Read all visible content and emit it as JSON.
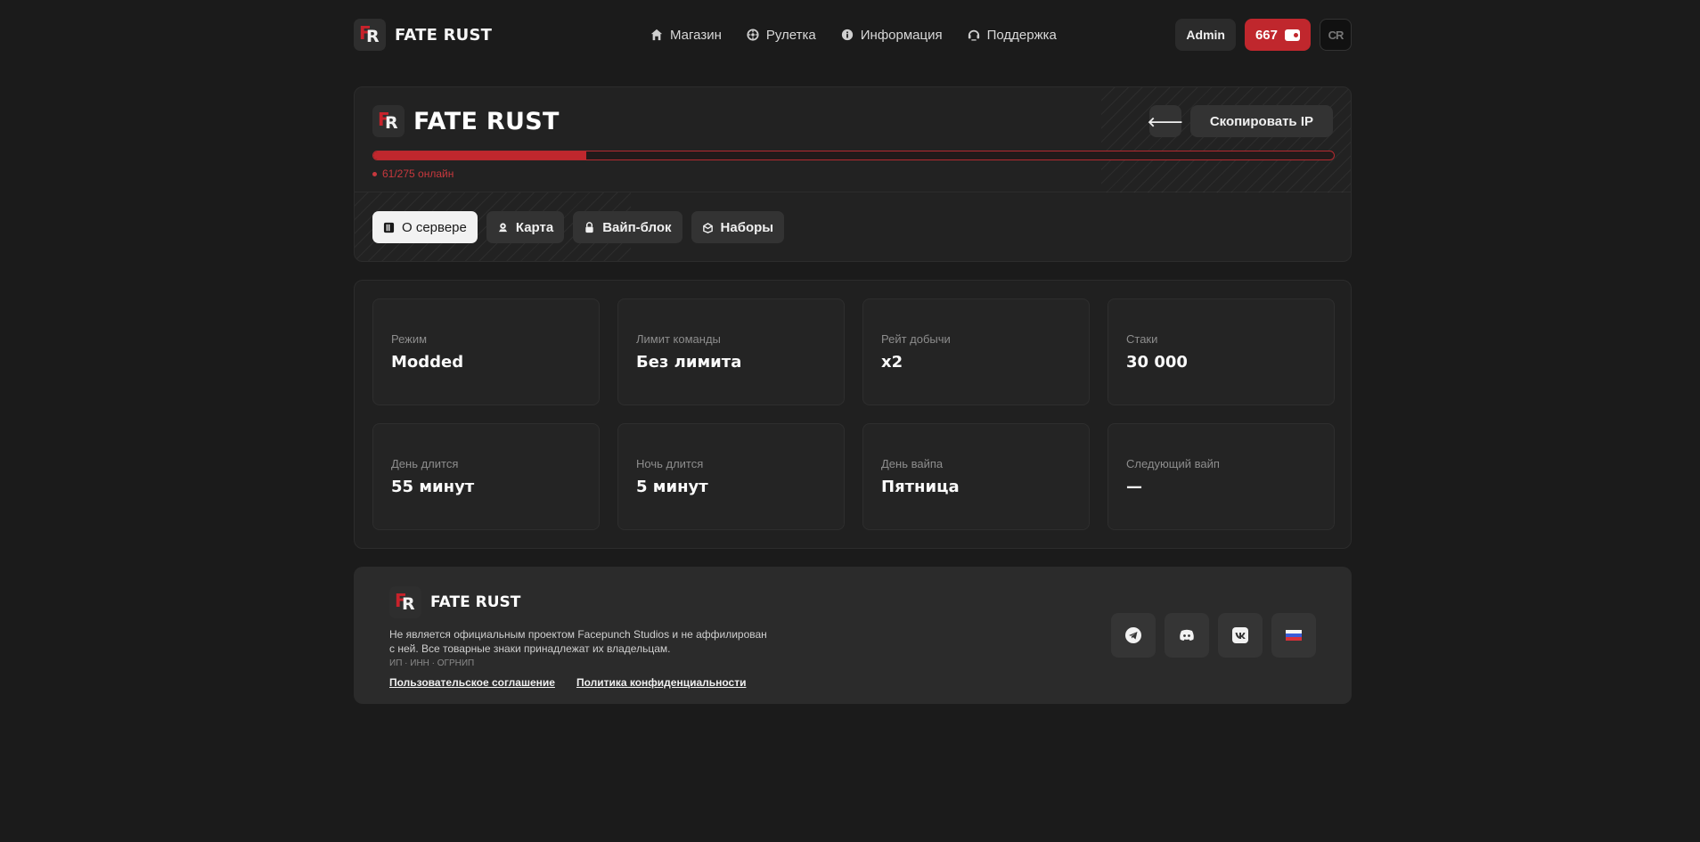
{
  "header": {
    "brand": "FATE RUST",
    "nav": [
      {
        "label": "Магазин",
        "icon": "home-icon"
      },
      {
        "label": "Рулетка",
        "icon": "roulette-icon"
      },
      {
        "label": "Информация",
        "icon": "info-icon"
      },
      {
        "label": "Поддержка",
        "icon": "support-icon"
      }
    ],
    "admin_label": "Admin",
    "balance": "667",
    "avatar_text": "CR"
  },
  "server": {
    "title": "FATE RUST",
    "copy_ip_label": "Скопировать IP",
    "back_symbol": "🡐",
    "online_text": "61/275 онлайн",
    "online_fraction": 0.2218,
    "tabs": [
      {
        "label": "О сервере",
        "icon": "book-icon",
        "active": true
      },
      {
        "label": "Карта",
        "icon": "map-pin-icon",
        "active": false
      },
      {
        "label": "Вайп-блок",
        "icon": "lock-icon",
        "active": false
      },
      {
        "label": "Наборы",
        "icon": "box-icon",
        "active": false
      }
    ]
  },
  "stats": [
    {
      "label": "Режим",
      "value": "Modded"
    },
    {
      "label": "Лимит команды",
      "value": "Без лимита"
    },
    {
      "label": "Рейт добычи",
      "value": "x2"
    },
    {
      "label": "Стаки",
      "value": "30 000"
    },
    {
      "label": "День длится",
      "value": "55 минут"
    },
    {
      "label": "Ночь длится",
      "value": "5 минут"
    },
    {
      "label": "День вайпа",
      "value": "Пятница"
    },
    {
      "label": "Следующий вайп",
      "value": "—"
    }
  ],
  "footer": {
    "brand": "FATE RUST",
    "disclaimer": "Не является официальным проектом Facepunch Studios и не аффилирован с ней. Все товарные знаки принадлежат их владельцам.",
    "ids": "ИП · ИНН · ОГРНИП",
    "links": [
      "Пользовательское соглашение",
      "Политика конфиденциальности"
    ],
    "socials": [
      "telegram-icon",
      "discord-icon",
      "vk-icon",
      "russian-flag-icon"
    ]
  },
  "colors": {
    "accent": "#c0272d",
    "background": "#1b1b1b",
    "card": "#222222"
  }
}
